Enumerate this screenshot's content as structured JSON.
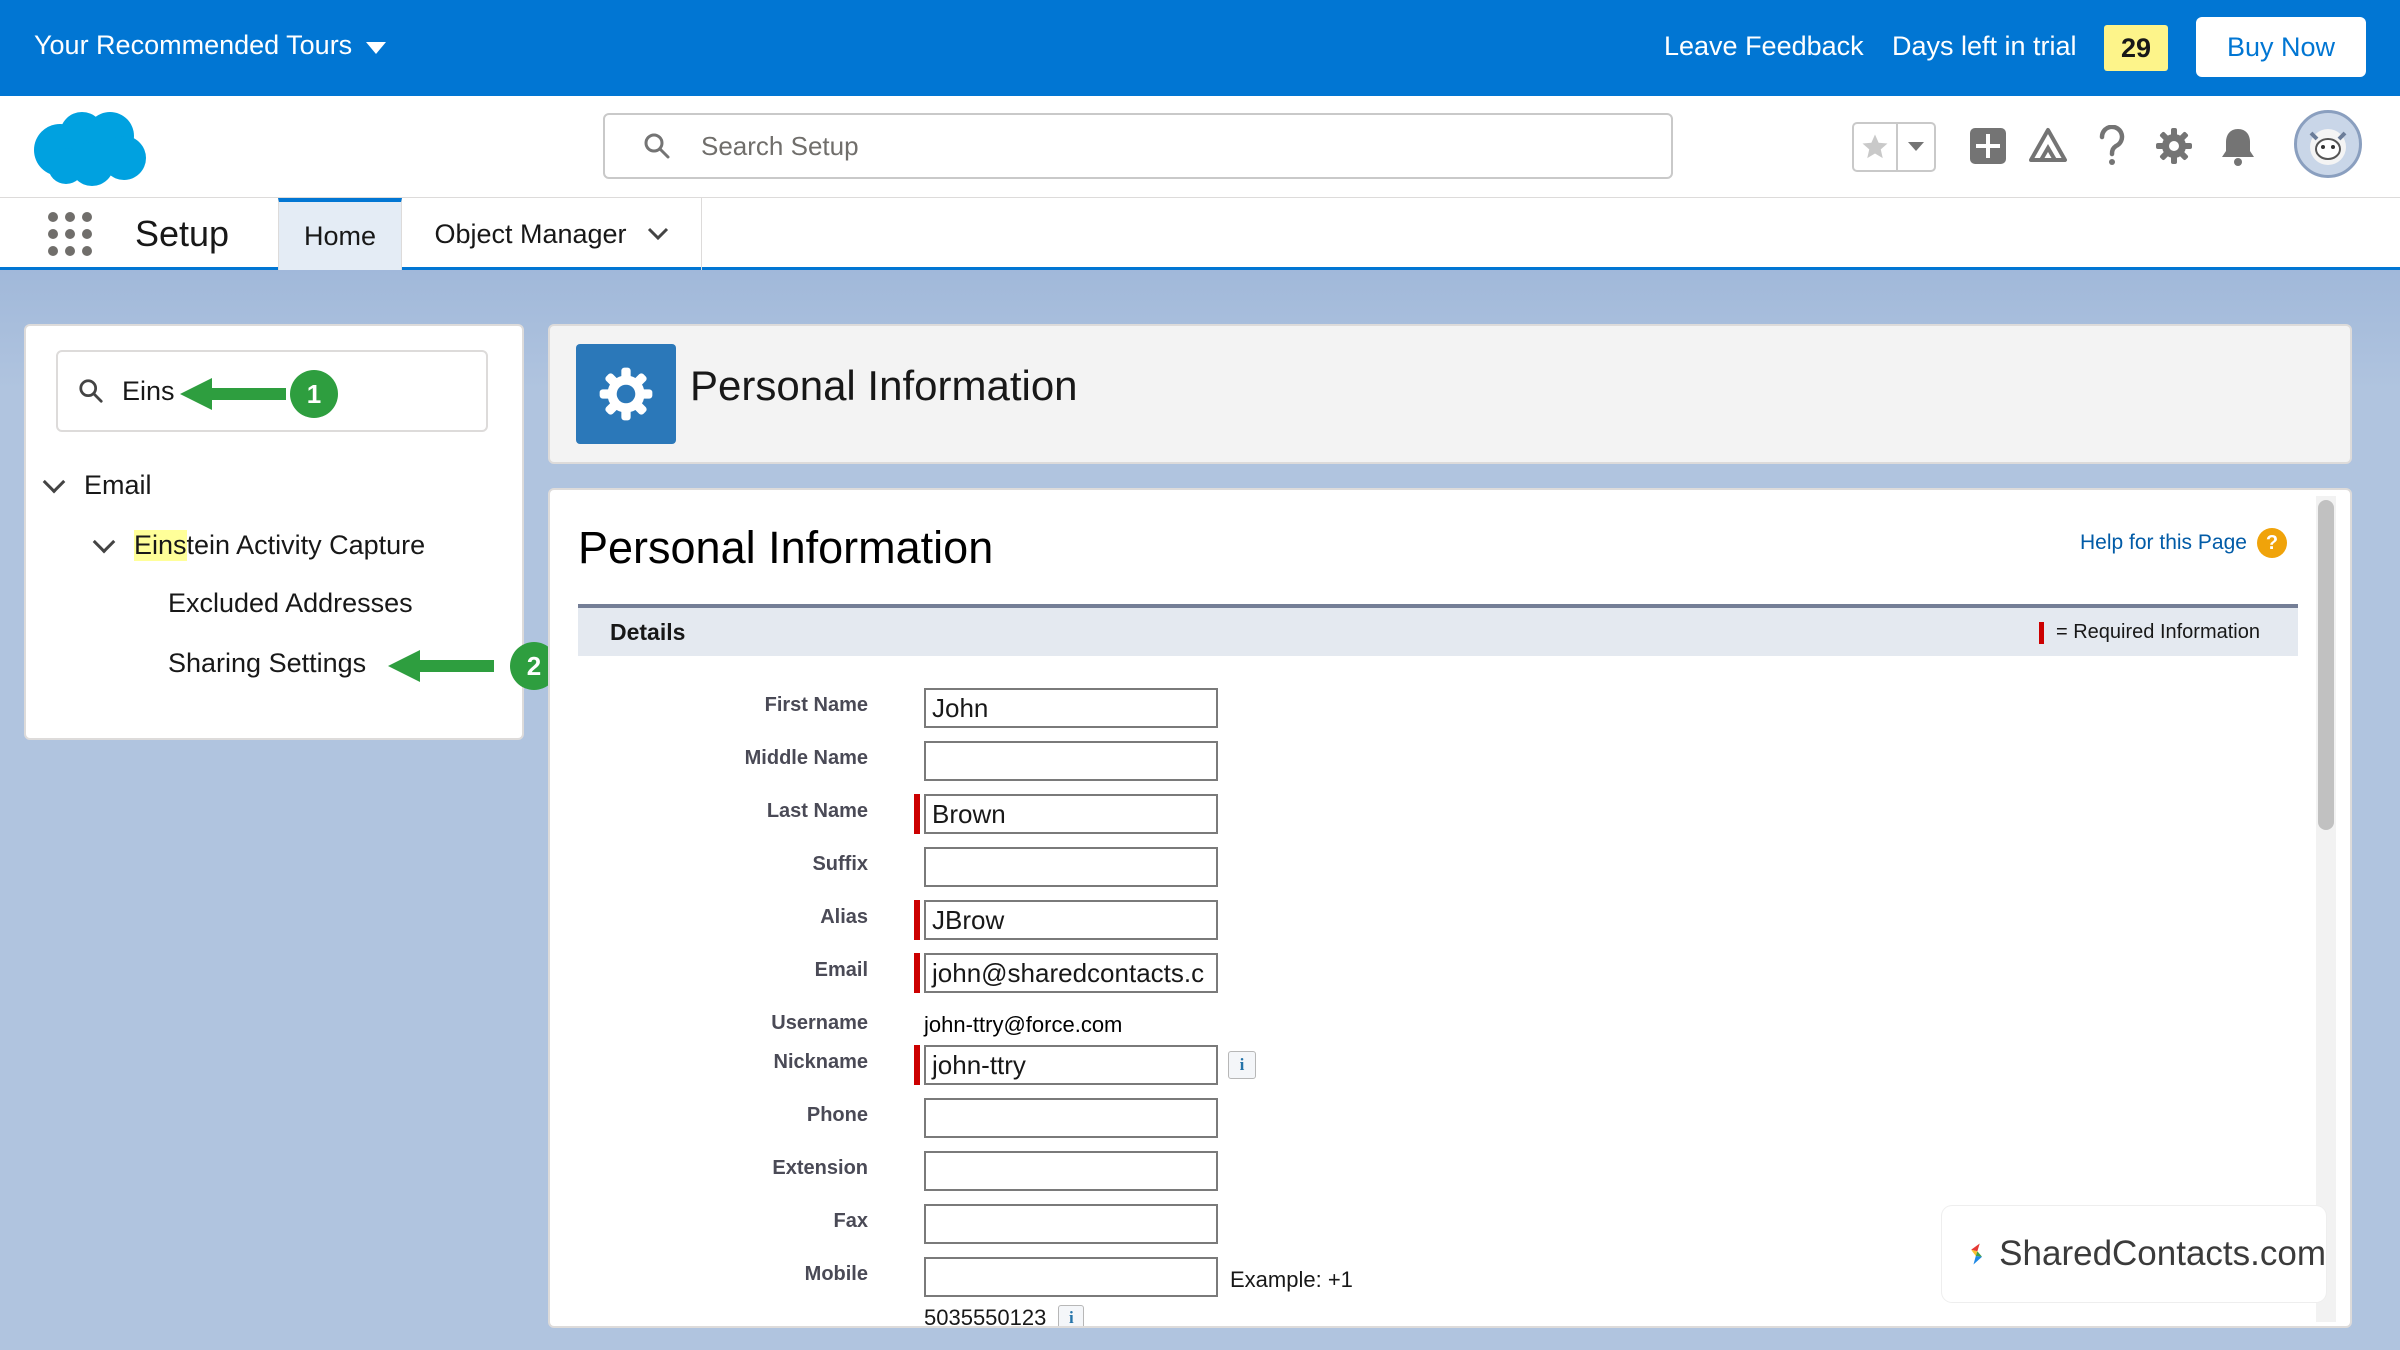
{
  "trial_bar": {
    "tours_label": "Your Recommended Tours",
    "feedback_label": "Leave Feedback",
    "days_left_label": "Days left in trial",
    "days_left_value": "29",
    "buy_now_label": "Buy Now"
  },
  "header": {
    "search_placeholder": "Search Setup"
  },
  "context_bar": {
    "app_name": "Setup",
    "tabs": [
      {
        "label": "Home",
        "active": true
      },
      {
        "label": "Object Manager",
        "active": false
      }
    ]
  },
  "sidebar": {
    "quick_find_value": "Eins",
    "tree": [
      {
        "label": "Email",
        "expanded": true
      },
      {
        "label_highlight": "Eins",
        "label_rest": "tein Activity Capture",
        "expanded": true
      },
      {
        "label": "Excluded Addresses"
      },
      {
        "label": "Sharing Settings"
      }
    ],
    "step_badges": [
      "1",
      "2"
    ]
  },
  "page_header": {
    "title": "Personal Information"
  },
  "content": {
    "title": "Personal Information",
    "help_link": "Help for this Page",
    "help_icon": "?",
    "section_label": "Details",
    "required_legend": "= Required Information",
    "fields": [
      {
        "label": "First Name",
        "value": "John",
        "required": false
      },
      {
        "label": "Middle Name",
        "value": "",
        "required": false
      },
      {
        "label": "Last Name",
        "value": "Brown",
        "required": true
      },
      {
        "label": "Suffix",
        "value": "",
        "required": false
      },
      {
        "label": "Alias",
        "value": "JBrow",
        "required": true
      },
      {
        "label": "Email",
        "value": "john@sharedcontacts.c",
        "required": true
      },
      {
        "label": "Username",
        "value": "john-ttry@force.com",
        "static": true
      },
      {
        "label": "Nickname",
        "value": "john-ttry",
        "required": true,
        "info": true
      },
      {
        "label": "Phone",
        "value": "",
        "required": false
      },
      {
        "label": "Extension",
        "value": "",
        "required": false
      },
      {
        "label": "Fax",
        "value": "",
        "required": false
      },
      {
        "label": "Mobile",
        "value": "",
        "required": false
      }
    ],
    "mobile_example_a": "Example: +1",
    "mobile_example_b": "5035550123",
    "info_glyph": "i"
  },
  "watermark": {
    "text": "SharedContacts.com"
  },
  "colors": {
    "brand_blue": "#0176d3",
    "trial_badge": "#fdf48a",
    "step_green": "#2e9e3f",
    "required_red": "#cc0000"
  }
}
